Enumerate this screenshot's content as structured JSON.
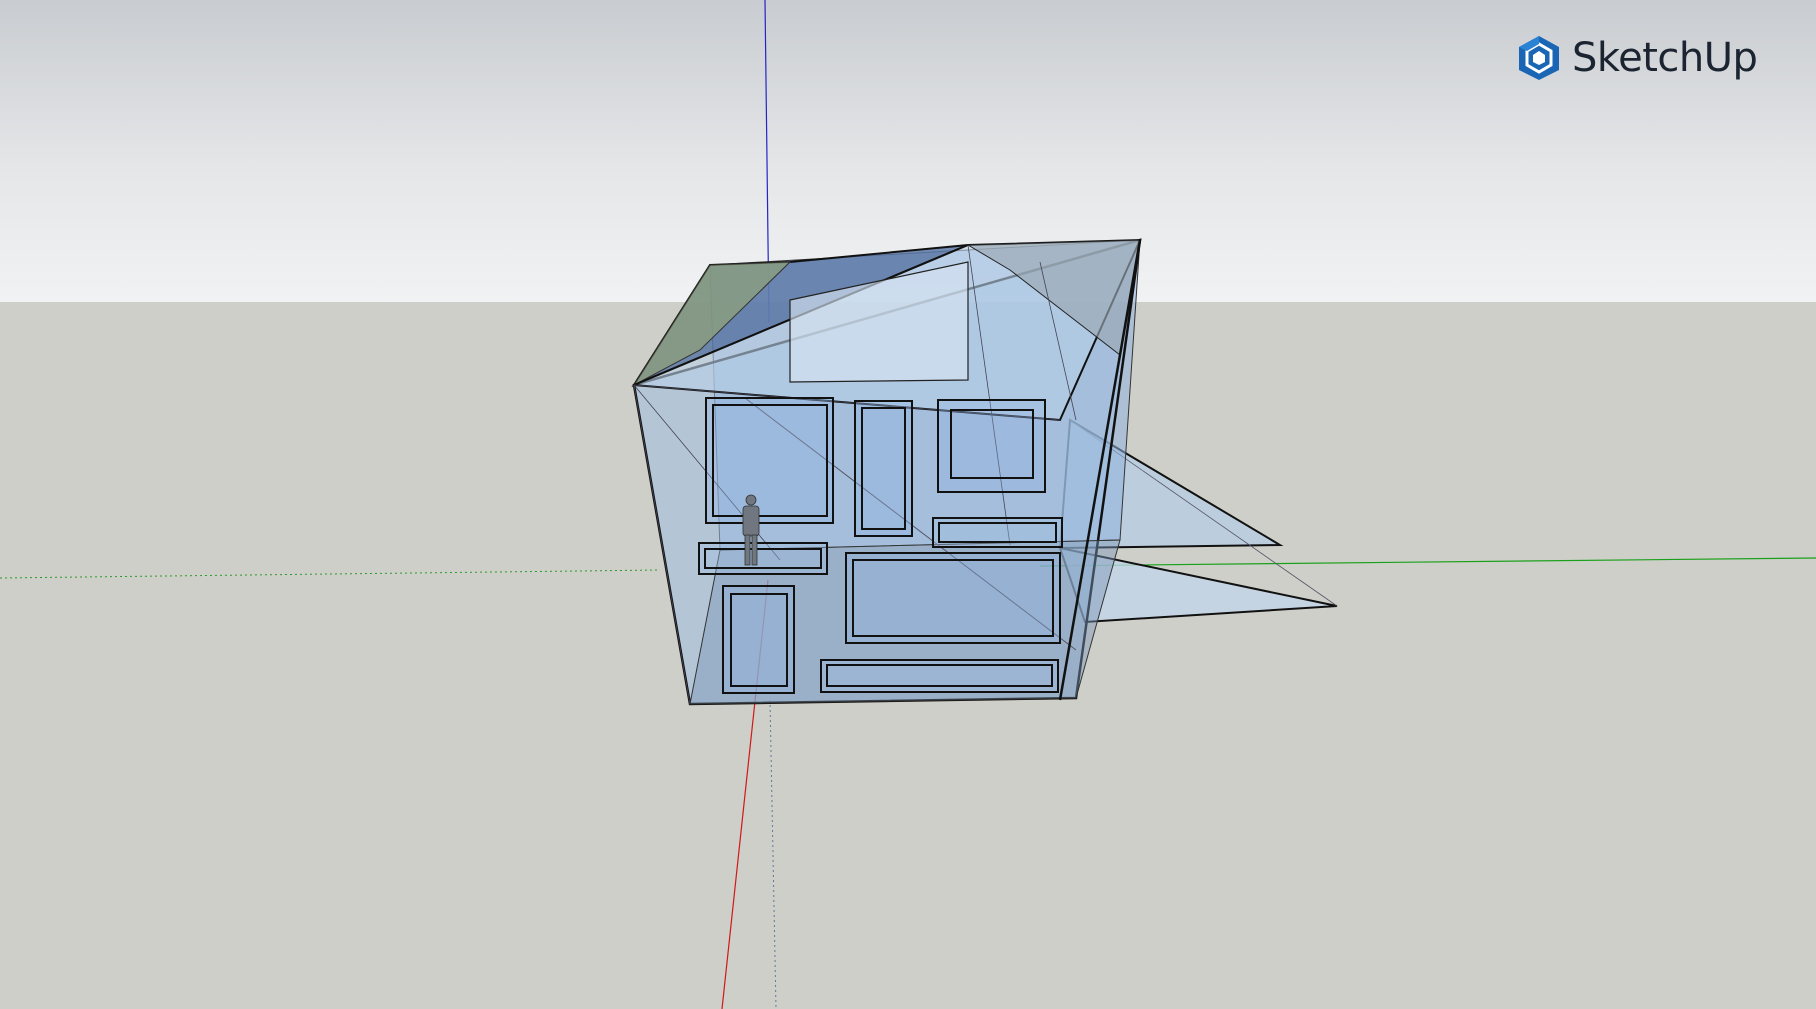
{
  "app": {
    "brand_name": "SketchUp",
    "brand_icon": "sketchup-logo-icon",
    "brand_color": "#1a66b4"
  },
  "viewport": {
    "sky_color": "#e4e6e8",
    "ground_color": "#cfcfc9",
    "axis_colors": {
      "red": "#d01818",
      "green": "#1aa01a",
      "blue": "#1a1ad0"
    },
    "model_face_color": "#a9c6e6",
    "model_edge_color": "#111111"
  }
}
